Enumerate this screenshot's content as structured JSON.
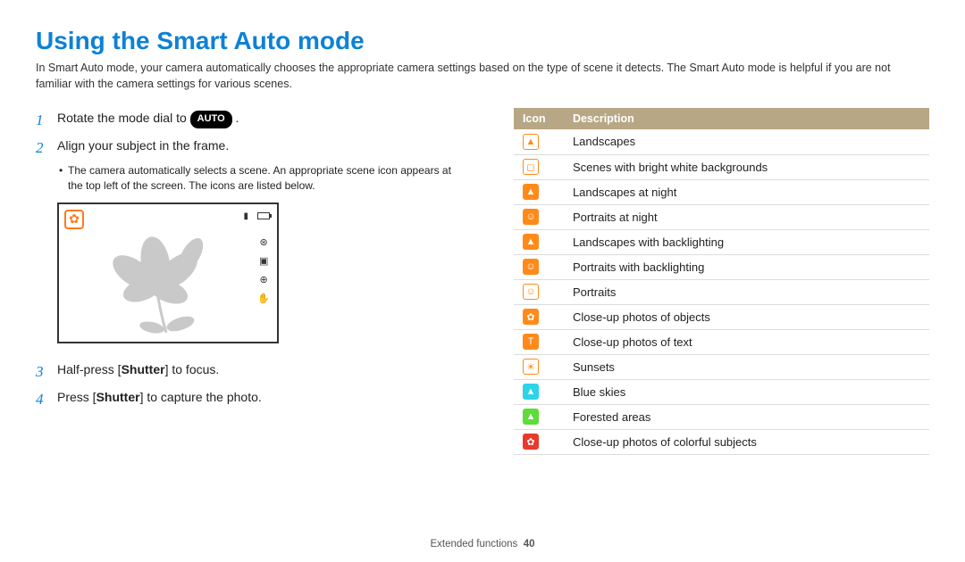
{
  "title": "Using the Smart Auto mode",
  "intro": "In Smart Auto mode, your camera automatically chooses the appropriate camera settings based on the type of scene it detects. The Smart Auto mode is helpful if you are not familiar with the camera settings for various scenes.",
  "steps": {
    "s1_pre": "Rotate the mode dial to ",
    "s1_badge": "AUTO",
    "s1_post": " .",
    "s2": "Align your subject in the frame.",
    "s2_sub": "The camera automatically selects a scene. An appropriate scene icon appears at the top left of the screen. The icons are listed below.",
    "s3_pre": "Half-press [",
    "s3_bold": "Shutter",
    "s3_post": "] to focus.",
    "s4_pre": "Press [",
    "s4_bold": "Shutter",
    "s4_post": "] to capture the photo."
  },
  "nums": {
    "n1": "1",
    "n2": "2",
    "n3": "3",
    "n4": "4"
  },
  "table": {
    "h_icon": "Icon",
    "h_desc": "Description",
    "rows": [
      {
        "desc": "Landscapes",
        "cls": "o-outline",
        "glyph": "▲"
      },
      {
        "desc": "Scenes with bright white backgrounds",
        "cls": "o-outline",
        "glyph": "◻"
      },
      {
        "desc": "Landscapes at night",
        "cls": "o-solid",
        "glyph": "▲"
      },
      {
        "desc": "Portraits at night",
        "cls": "o-solid",
        "glyph": "☺"
      },
      {
        "desc": "Landscapes with backlighting",
        "cls": "o-solid",
        "glyph": "▲"
      },
      {
        "desc": "Portraits with backlighting",
        "cls": "o-solid",
        "glyph": "☺"
      },
      {
        "desc": "Portraits",
        "cls": "o-outline",
        "glyph": "☺"
      },
      {
        "desc": "Close-up photos of objects",
        "cls": "o-solid",
        "glyph": "✿"
      },
      {
        "desc": "Close-up photos of text",
        "cls": "o-solid",
        "glyph": "T"
      },
      {
        "desc": "Sunsets",
        "cls": "o-outline",
        "glyph": "☀"
      },
      {
        "desc": "Blue skies",
        "cls": "cyan",
        "glyph": "▲"
      },
      {
        "desc": "Forested areas",
        "cls": "green",
        "glyph": "▲"
      },
      {
        "desc": "Close-up photos of colorful subjects",
        "cls": "red",
        "glyph": "✿"
      }
    ]
  },
  "footer": {
    "section": "Extended functions",
    "page": "40"
  },
  "preview": {
    "corner_icon_name": "macro-flower-icon",
    "top_bar_glyph": "▮",
    "side": [
      "⊛",
      "▣",
      "⊕",
      "✋"
    ]
  }
}
